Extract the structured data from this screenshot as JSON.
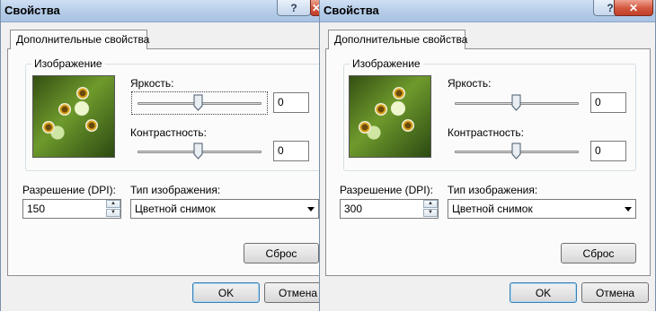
{
  "dialogs": [
    {
      "title": "Свойства",
      "help_glyph": "?",
      "close_glyph": "✕",
      "tab_label": "Дополнительные свойства",
      "group_label": "Изображение",
      "brightness_label": "Яркость:",
      "brightness_value": "0",
      "contrast_label": "Контрастность:",
      "contrast_value": "0",
      "resolution_label": "Разрешение (DPI):",
      "resolution_value": "150",
      "image_type_label": "Тип изображения:",
      "image_type_value": "Цветной снимок",
      "reset_label": "Сброс",
      "ok_label": "OK",
      "cancel_label": "Отмена"
    },
    {
      "title": "Свойства",
      "help_glyph": "?",
      "close_glyph": "✕",
      "tab_label": "Дополнительные свойства",
      "group_label": "Изображение",
      "brightness_label": "Яркость:",
      "brightness_value": "0",
      "contrast_label": "Контрастность:",
      "contrast_value": "0",
      "resolution_label": "Разрешение (DPI):",
      "resolution_value": "300",
      "image_type_label": "Тип изображения:",
      "image_type_value": "Цветной снимок",
      "reset_label": "Сброс",
      "ok_label": "OK",
      "cancel_label": "Отмена"
    }
  ],
  "colors": {
    "titlebar": "#b3cbe7",
    "close_button": "#c0402a",
    "dialog_bg": "#f0f0f0",
    "default_button_border": "#3c7fb1"
  }
}
